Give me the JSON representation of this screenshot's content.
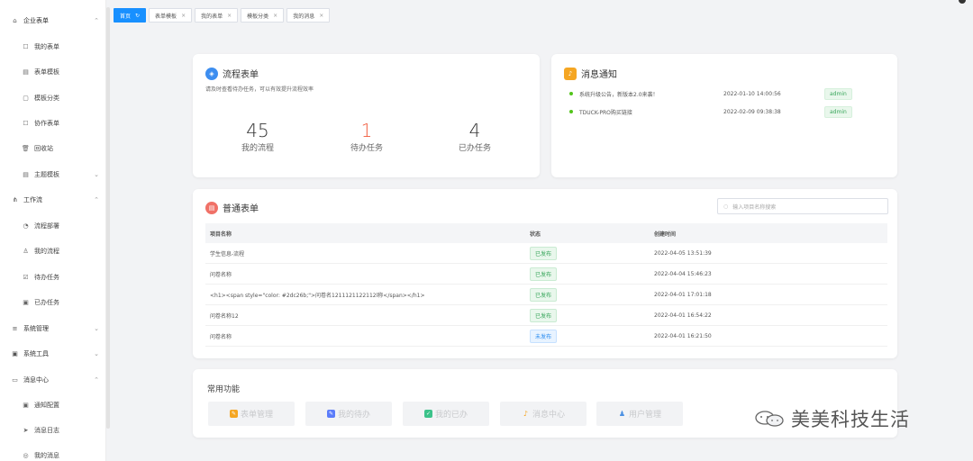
{
  "sidebar": {
    "groups": [
      {
        "label": "企业表单",
        "icon": "building-icon",
        "chevron": "⌃"
      },
      {
        "label": "工作流",
        "icon": "workflow-icon",
        "chevron": "⌃"
      },
      {
        "label": "系统管理",
        "icon": "list-icon",
        "chevron": "⌄"
      },
      {
        "label": "系统工具",
        "icon": "tool-icon",
        "chevron": "⌄"
      },
      {
        "label": "消息中心",
        "icon": "message-icon",
        "chevron": "⌃"
      }
    ],
    "form_items": [
      {
        "label": "我的表单",
        "glyph": "☐"
      },
      {
        "label": "表单模板",
        "glyph": "▤"
      },
      {
        "label": "模板分类",
        "glyph": "▢"
      },
      {
        "label": "协作表单",
        "glyph": "☐"
      },
      {
        "label": "回收站",
        "glyph": "🗑"
      },
      {
        "label": "主题模板",
        "glyph": "▤",
        "chevron": "⌄"
      }
    ],
    "workflow_items": [
      {
        "label": "流程部署",
        "glyph": "◔"
      },
      {
        "label": "我的流程",
        "glyph": "♙"
      },
      {
        "label": "待办任务",
        "glyph": "☑"
      },
      {
        "label": "已办任务",
        "glyph": "▣"
      }
    ],
    "message_items": [
      {
        "label": "通知配置",
        "glyph": "▣"
      },
      {
        "label": "消息日志",
        "glyph": "➤"
      },
      {
        "label": "我的消息",
        "glyph": "◎"
      }
    ]
  },
  "tabs": [
    {
      "label": "首页",
      "active": true,
      "suffix": "↻"
    },
    {
      "label": "表单模板",
      "active": false,
      "suffix": "×"
    },
    {
      "label": "我的表单",
      "active": false,
      "suffix": "×"
    },
    {
      "label": "模板分类",
      "active": false,
      "suffix": "×"
    },
    {
      "label": "我的消息",
      "active": false,
      "suffix": "×"
    }
  ],
  "flow_card": {
    "title": "流程表单",
    "subtitle": "请及时查看待办任务，可以有效提升流程效率",
    "stats": [
      {
        "value": "45",
        "label": "我的流程"
      },
      {
        "value": "1",
        "label": "待办任务"
      },
      {
        "value": "4",
        "label": "已办任务"
      }
    ]
  },
  "notice_card": {
    "title": "消息通知",
    "items": [
      {
        "title": "系统升级公告，新版本2.0来袭！",
        "time": "2022-01-10 14:00:56",
        "tag": "admin"
      },
      {
        "title": "TDUCK-PRO购买链接",
        "time": "2022-02-09 09:38:38",
        "tag": "admin"
      }
    ]
  },
  "form_card": {
    "title": "普通表单",
    "search_placeholder": "输入项目名称搜索",
    "columns": [
      "项目名称",
      "状态",
      "创建时间"
    ],
    "rows": [
      {
        "name": "学生信息-流程",
        "status": "已发布",
        "status_kind": "pub",
        "created": "2022-04-05 13:51:39"
      },
      {
        "name": "问卷名称",
        "status": "已发布",
        "status_kind": "pub",
        "created": "2022-04-04 15:46:23"
      },
      {
        "name": "<h1><span style=\"color: #2dc26b;\">问卷名1211121122112l称</span></h1>",
        "status": "已发布",
        "status_kind": "pub",
        "created": "2022-04-01 17:01:18"
      },
      {
        "name": "问卷名称12",
        "status": "已发布",
        "status_kind": "pub",
        "created": "2022-04-01 16:54:22"
      },
      {
        "name": "问卷名称",
        "status": "未发布",
        "status_kind": "unpub",
        "created": "2022-04-01 16:21:50"
      }
    ]
  },
  "quick_card": {
    "title": "常用功能",
    "buttons": [
      {
        "label": "表单管理",
        "icon_color": "#f5a623"
      },
      {
        "label": "我的待办",
        "icon_color": "#5b7cfa"
      },
      {
        "label": "我的已办",
        "icon_color": "#3cc28a"
      },
      {
        "label": "消息中心",
        "icon_color": "#f5a623"
      },
      {
        "label": "用户管理",
        "icon_color": "#4a90e2"
      }
    ]
  },
  "watermark": {
    "text": "美美科技生活"
  },
  "colors": {
    "primary": "#1890ff",
    "accent_red": "#f15a3c",
    "success": "#37a55a"
  }
}
